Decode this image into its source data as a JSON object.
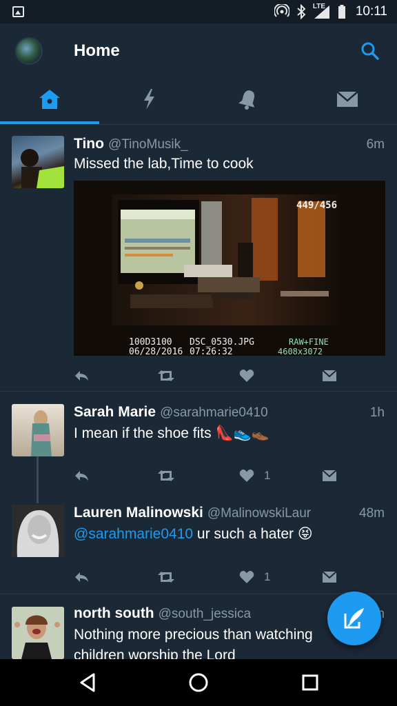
{
  "status_bar": {
    "network_label": "LTE",
    "time": "10:11"
  },
  "header": {
    "title": "Home"
  },
  "tabs": [
    {
      "name": "home",
      "icon": "home-icon",
      "active": true
    },
    {
      "name": "moments",
      "icon": "lightning-icon",
      "active": false
    },
    {
      "name": "notifications",
      "icon": "bell-icon",
      "active": false
    },
    {
      "name": "messages",
      "icon": "mail-icon",
      "active": false
    }
  ],
  "tweets": [
    {
      "name": "Tino",
      "handle": "@TinoMusik_",
      "time": "6m",
      "text": "Missed the lab,Time to cook",
      "media": {
        "counter": "449/456",
        "folder": "100D3100",
        "file": "DSC_0530.JPG",
        "date": "06/28/2016",
        "clock": "07:26:32",
        "quality": "RAW+FINE",
        "size": "4608x3072"
      },
      "likes": ""
    },
    {
      "name": "Sarah Marie",
      "handle": "@sarahmarie0410",
      "time": "1h",
      "text": "I mean if the shoe fits",
      "emoji": "👠👟👞",
      "likes": "1"
    },
    {
      "name": "Lauren Malinowski",
      "handle": "@MalinowskiLaur",
      "time": "48m",
      "mention": "@sarahmarie0410",
      "text": " ur such a hater",
      "emoji": "😝",
      "likes": "1"
    },
    {
      "name": "north south",
      "handle": "@south_jessica",
      "time": "1h",
      "text": "Nothing more precious than watching children worship the Lord"
    }
  ],
  "colors": {
    "accent": "#1d9bf0",
    "background": "#1b2836",
    "secondary_text": "#8899a6"
  }
}
